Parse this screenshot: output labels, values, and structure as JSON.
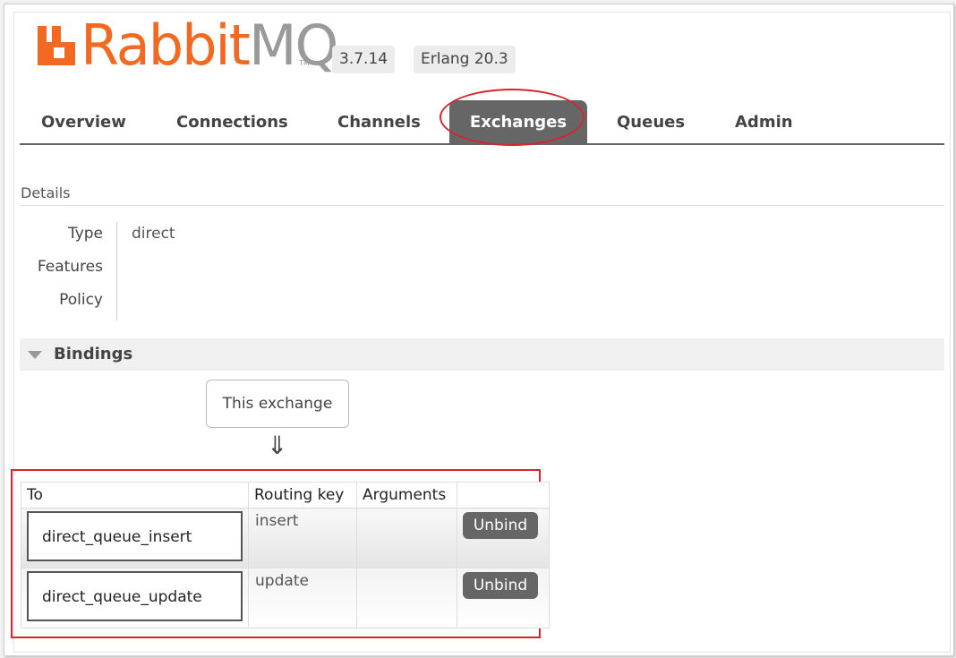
{
  "logo": {
    "rabbit": "Rabbit",
    "mq": "MQ",
    "tm": "TM"
  },
  "badges": {
    "version": "3.7.14",
    "erlang": "Erlang 20.3"
  },
  "nav": {
    "tabs": [
      "Overview",
      "Connections",
      "Channels",
      "Exchanges",
      "Queues",
      "Admin"
    ],
    "active": "Exchanges"
  },
  "details": {
    "heading": "Details",
    "rows": [
      {
        "key": "Type",
        "value": "direct"
      },
      {
        "key": "Features",
        "value": ""
      },
      {
        "key": "Policy",
        "value": ""
      }
    ]
  },
  "bindings": {
    "heading": "Bindings",
    "this_exchange": "This exchange",
    "arrow": "⇓",
    "columns": [
      "To",
      "Routing key",
      "Arguments",
      ""
    ],
    "rows": [
      {
        "to": "direct_queue_insert",
        "routing_key": "insert",
        "arguments": "",
        "action": "Unbind"
      },
      {
        "to": "direct_queue_update",
        "routing_key": "update",
        "arguments": "",
        "action": "Unbind"
      }
    ]
  },
  "colors": {
    "brand_orange": "#f26a21",
    "tab_active": "#666666",
    "highlight_red": "#d6252f"
  }
}
